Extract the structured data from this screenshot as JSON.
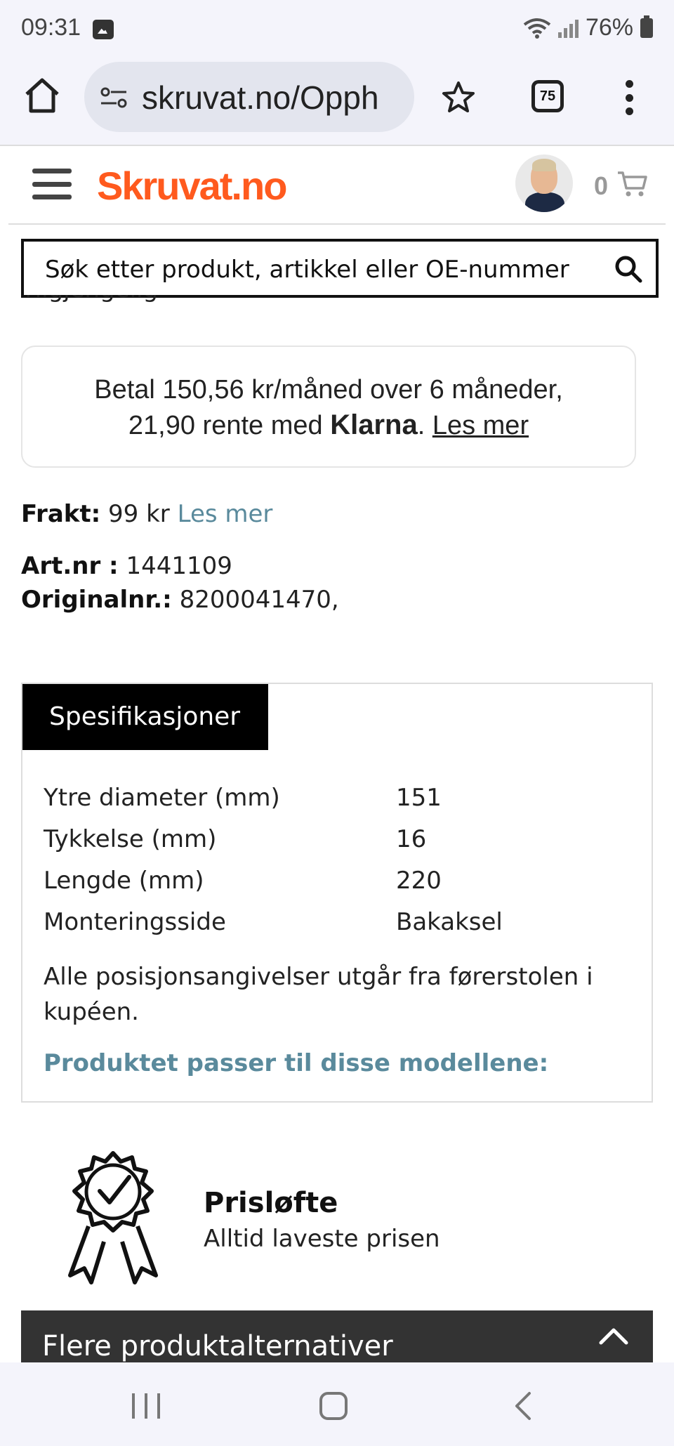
{
  "status_bar": {
    "time": "09:31",
    "battery": "76%"
  },
  "browser": {
    "url": "skruvat.no/Opph",
    "tab_count": "75"
  },
  "site": {
    "logo": "Skruvat.no",
    "cart_count": "0"
  },
  "search": {
    "placeholder": "Søk etter produkt, artikkel eller OE-nummer"
  },
  "cut_text": "Tilgjengelig",
  "klarna": {
    "line1": "Betal 150,56 kr/måned over 6 måneder,",
    "line2_pre": "21,90 rente med",
    "brand": "Klarna",
    "dot": ".",
    "link": "Les mer"
  },
  "shipping": {
    "label": "Frakt:",
    "value": "99 kr",
    "link": "Les mer"
  },
  "article": {
    "label": "Art.nr :",
    "value": "1441109"
  },
  "original": {
    "label": "Originalnr.:",
    "value": "8200041470,"
  },
  "specs": {
    "tab": "Spesifikasjoner",
    "rows": [
      {
        "key": "Ytre diameter (mm)",
        "value": "151"
      },
      {
        "key": "Tykkelse (mm)",
        "value": "16"
      },
      {
        "key": "Lengde (mm)",
        "value": "220"
      },
      {
        "key": "Monteringsside",
        "value": "Bakaksel"
      }
    ],
    "note": "Alle posisjonsangivelser utgår fra førerstolen i kupéen.",
    "fits": "Produktet passer til disse modellene:"
  },
  "promise": {
    "title": "Prisløfte",
    "subtitle": "Alltid laveste prisen"
  },
  "accordion": {
    "label": "Flere produktalternativer"
  }
}
